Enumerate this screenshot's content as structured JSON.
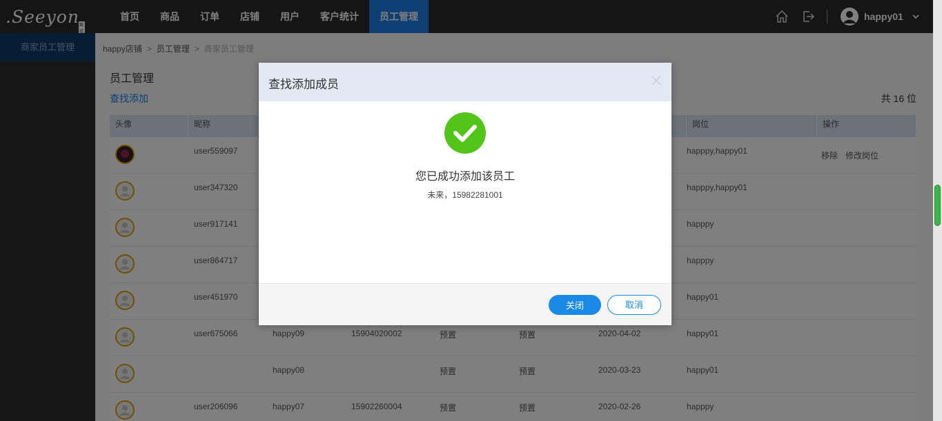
{
  "header": {
    "logo_text": ".Seeyon",
    "logo_badge": "致远",
    "nav": [
      {
        "label": "首页"
      },
      {
        "label": "商品"
      },
      {
        "label": "订单"
      },
      {
        "label": "店铺"
      },
      {
        "label": "用户"
      },
      {
        "label": "客户统计"
      },
      {
        "label": "员工管理",
        "active": true
      }
    ],
    "username": "happy01",
    "icons": {
      "home": "home-icon",
      "logout": "logout-icon",
      "avatar": "user-avatar-icon",
      "dropdown": "chevron-down-icon"
    }
  },
  "sidebar": {
    "items": [
      {
        "label": "商家员工管理"
      }
    ]
  },
  "breadcrumb": {
    "items": [
      "happy店铺",
      "员工管理",
      "商家员工管理"
    ],
    "separator": ">"
  },
  "page": {
    "title": "员工管理",
    "add_link": "查找添加",
    "total": "共 16 位"
  },
  "table": {
    "headers": [
      "头像",
      "昵称",
      "",
      "",
      "",
      "",
      "",
      "岗位",
      "操作"
    ],
    "rows": [
      {
        "nick": "user559097",
        "name": "",
        "phone": "",
        "a": "",
        "b": "",
        "date": "",
        "pos": "happpy,happy01",
        "ops": [
          "移除",
          "修改岗位"
        ],
        "photo": true
      },
      {
        "nick": "user347320",
        "name": "",
        "phone": "",
        "a": "",
        "b": "",
        "date": "",
        "pos": "happpy,happy01",
        "ops": []
      },
      {
        "nick": "user917141",
        "name": "",
        "phone": "",
        "a": "",
        "b": "",
        "date": "",
        "pos": "happpy",
        "ops": []
      },
      {
        "nick": "user864717",
        "name": "",
        "phone": "",
        "a": "",
        "b": "",
        "date": "",
        "pos": "happpy",
        "ops": []
      },
      {
        "nick": "user451970",
        "name": "",
        "phone": "",
        "a": "",
        "b": "",
        "date": "",
        "pos": "happy01",
        "ops": []
      },
      {
        "nick": "user675066",
        "name": "happy09",
        "phone": "15904020002",
        "a": "预置",
        "b": "预置",
        "date": "2020-04-02",
        "pos": "happy01",
        "ops": []
      },
      {
        "nick": "",
        "name": "happy08",
        "phone": "",
        "a": "预置",
        "b": "预置",
        "date": "2020-03-23",
        "pos": "happy01",
        "ops": []
      },
      {
        "nick": "user206096",
        "name": "happy07",
        "phone": "15902260004",
        "a": "预置",
        "b": "预置",
        "date": "2020-02-26",
        "pos": "happpy",
        "ops": []
      }
    ]
  },
  "modal": {
    "title": "查找添加成员",
    "message": "您已成功添加该员工",
    "detail": "未来，15982281001",
    "close_label": "关闭",
    "cancel_label": "取消",
    "icons": {
      "close": "close-icon",
      "success": "checkmark-circle-icon"
    },
    "colors": {
      "success": "#52c41a",
      "primary": "#1a8ae6"
    }
  }
}
